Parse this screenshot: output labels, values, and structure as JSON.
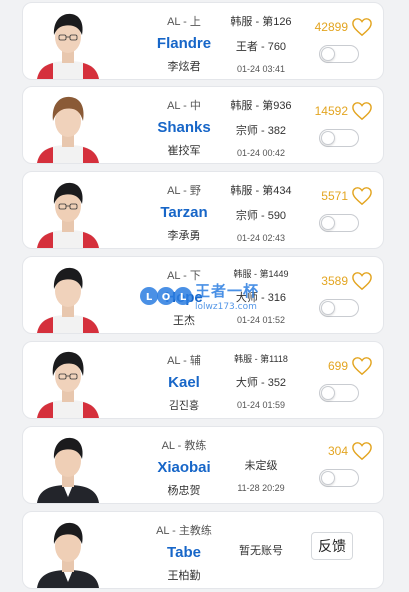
{
  "players": [
    {
      "team_pos": "AL - 上",
      "name": "Flandre",
      "cn_name": "李炫君",
      "server": "韩服 - 第126",
      "tier": "王者 - 760",
      "time": "01-24 03:41",
      "likes": "42899",
      "has_account": true
    },
    {
      "team_pos": "AL - 中",
      "name": "Shanks",
      "cn_name": "崔挍军",
      "server": "韩服 - 第936",
      "tier": "宗师 - 382",
      "time": "01-24 00:42",
      "likes": "14592",
      "has_account": true
    },
    {
      "team_pos": "AL - 野",
      "name": "Tarzan",
      "cn_name": "李承勇",
      "server": "韩服 - 第434",
      "tier": "宗师 - 590",
      "time": "01-24 02:43",
      "likes": "5571",
      "has_account": true
    },
    {
      "team_pos": "AL - 下",
      "name": "Hope",
      "cn_name": "王杰",
      "server": "韩服 - 第1449",
      "tier": "大师 - 316",
      "time": "01-24 01:52",
      "likes": "3589",
      "has_account": true
    },
    {
      "team_pos": "AL - 辅",
      "name": "Kael",
      "cn_name": "김진홍",
      "server": "韩服 - 第1118",
      "tier": "大师 - 352",
      "time": "01-24 01:59",
      "likes": "699",
      "has_account": true
    },
    {
      "team_pos": "AL - 教练",
      "name": "Xiaobai",
      "cn_name": "杨忠贺",
      "server": "",
      "tier": "未定级",
      "time": "11-28 20:29",
      "likes": "304",
      "has_account": true
    },
    {
      "team_pos": "AL - 主教练",
      "name": "Tabe",
      "cn_name": "王柏勤",
      "no_account": "暂无账号",
      "feedback": "反馈",
      "has_account": false
    }
  ],
  "watermark": {
    "logo_text": "lolwz",
    "title": "王者一杯",
    "url": "lolwz173.com"
  },
  "colors": {
    "accent": "#1766c8",
    "likes": "#e3a521",
    "watermark": "#2a7de1"
  }
}
